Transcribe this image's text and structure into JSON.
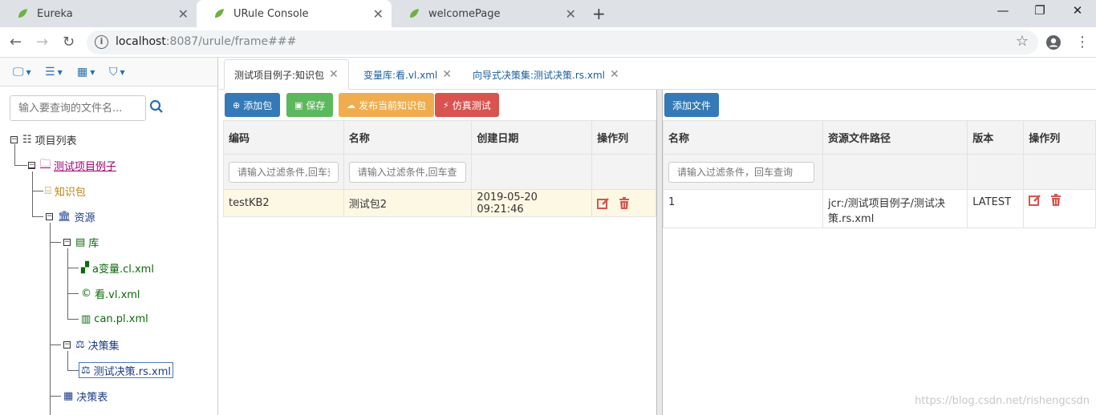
{
  "browser": {
    "tabs": [
      {
        "title": "Eureka"
      },
      {
        "title": "URule Console"
      },
      {
        "title": "welcomePage"
      }
    ],
    "url_host": "localhost",
    "url_rest": ":8087/urule/frame###"
  },
  "sidebar": {
    "search_placeholder": "输入要查询的文件名...",
    "tree": {
      "root": "项目列表",
      "project": "测试项目例子",
      "knowledge_pkg": "知识包",
      "resources": "资源",
      "library": "库",
      "lib_items": [
        "a变量.cl.xml",
        "看.vl.xml",
        "can.pl.xml"
      ],
      "ruleset": "决策集",
      "ruleset_item": "测试决策.rs.xml",
      "decision_table": "决策表"
    }
  },
  "tabs": [
    {
      "label": "测试项目例子:知识包"
    },
    {
      "label": "变量库:看.vl.xml"
    },
    {
      "label": "向导式决策集:测试决策.rs.xml"
    }
  ],
  "left_panel": {
    "buttons": {
      "add_pkg": "添加包",
      "save": "保存",
      "publish": "发布当前知识包",
      "simulate": "仿真测试"
    },
    "columns": [
      "编码",
      "名称",
      "创建日期",
      "操作列"
    ],
    "filter_placeholder": "请输入过滤条件,回车查询",
    "rows": [
      {
        "code": "testKB2",
        "name": "测试包2",
        "date": "2019-05-20 09:21:46"
      }
    ]
  },
  "right_panel": {
    "buttons": {
      "add_file": "添加文件"
    },
    "columns": [
      "名称",
      "资源文件路径",
      "版本",
      "操作列"
    ],
    "filter_placeholder": "请输入过滤条件，回车查询",
    "rows": [
      {
        "name": "1",
        "path": "jcr:/测试项目例子/测试决策.rs.xml",
        "version": "LATEST"
      }
    ]
  },
  "watermark": "https://blog.csdn.net/rishengcsdn",
  "colors": {
    "primary": "#337ab7",
    "success": "#5cb85c",
    "warning": "#f0ad4e",
    "danger": "#d9534f"
  }
}
